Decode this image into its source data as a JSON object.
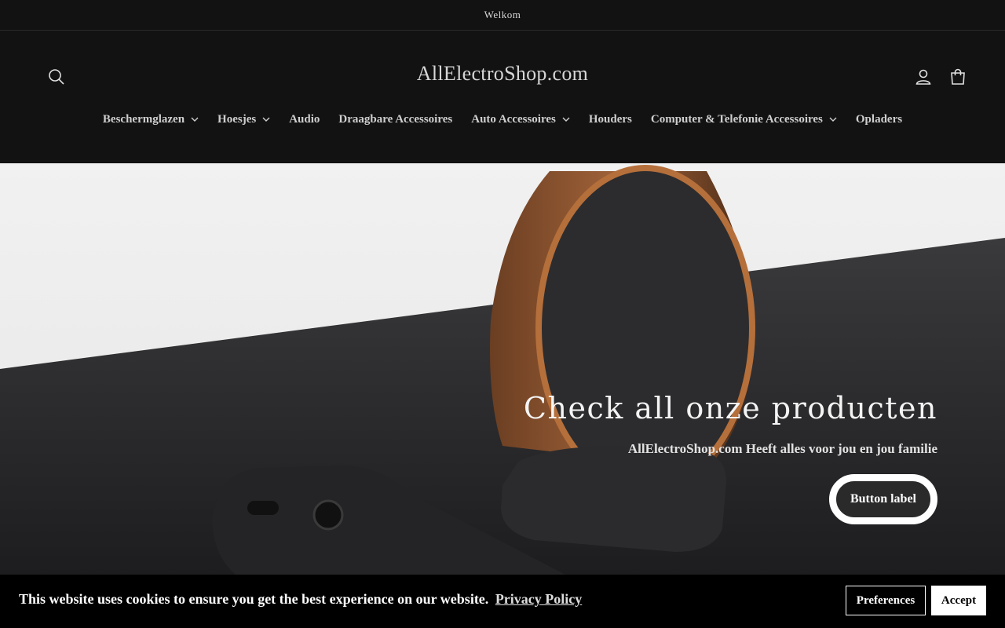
{
  "announcement": {
    "text": "Welkom"
  },
  "header": {
    "logo": "AllElectroShop.com",
    "icons": {
      "search": "search-icon",
      "account": "user-icon",
      "cart": "bag-icon"
    }
  },
  "nav": {
    "items": [
      {
        "label": "Beschermglazen",
        "dropdown": true
      },
      {
        "label": "Hoesjes",
        "dropdown": true
      },
      {
        "label": "Audio",
        "dropdown": false
      },
      {
        "label": "Draagbare Accessoires",
        "dropdown": false
      },
      {
        "label": "Auto Accessoires",
        "dropdown": true
      },
      {
        "label": "Houders",
        "dropdown": false
      },
      {
        "label": "Computer & Telefonie Accessoires",
        "dropdown": true
      },
      {
        "label": "Opladers",
        "dropdown": false
      }
    ]
  },
  "hero": {
    "title": "Check all onze producten",
    "subtitle": "AllElectroShop.com Heeft alles voor jou en jou familie",
    "button_label": "Button label"
  },
  "cookie": {
    "message": "This website uses cookies to ensure you get the best experience on our website.",
    "link_label": "Privacy Policy",
    "preferences_label": "Preferences",
    "accept_label": "Accept"
  },
  "colors": {
    "background": "#121212",
    "text": "#cfcfcf",
    "cookie_bg": "#000000"
  }
}
